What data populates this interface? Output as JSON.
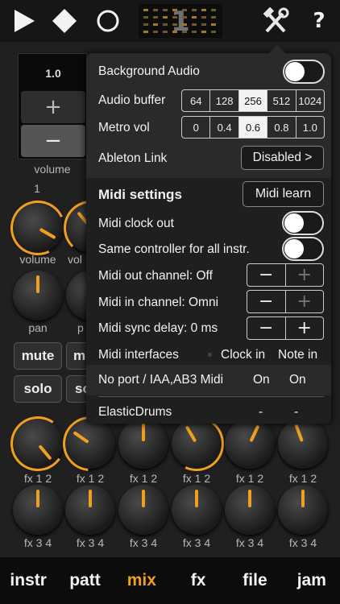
{
  "toolbar": {
    "play": "play-icon",
    "stop": "stop-icon",
    "record": "record-icon",
    "pattern_number": "1",
    "tools": "tools-icon",
    "help_label": "?"
  },
  "mixer": {
    "volume_value": "1.0",
    "volume_plus": "+",
    "volume_minus": "−",
    "volume_label": "volume",
    "channel_number": "1",
    "knob_volume": "volume",
    "knob_volume_partial": "vol",
    "knob_pan": "pan",
    "knob_pan_partial": "p",
    "mute": "mute",
    "mute_partial": "m",
    "solo": "solo",
    "solo_partial": "so",
    "fx12": "fx 1 2",
    "fx34": "fx 3 4"
  },
  "settings": {
    "background_audio": {
      "label": "Background Audio",
      "on": false
    },
    "audio_buffer": {
      "label": "Audio buffer",
      "options": [
        "64",
        "128",
        "256",
        "512",
        "1024"
      ],
      "selected": "256"
    },
    "metro_vol": {
      "label": "Metro vol",
      "options": [
        "0",
        "0.4",
        "0.6",
        "0.8",
        "1.0"
      ],
      "selected": "0.6"
    },
    "ableton_link": {
      "label": "Ableton Link",
      "value": "Disabled >"
    },
    "midi_settings": {
      "label": "Midi settings",
      "learn": "Midi learn"
    },
    "midi_clock_out": {
      "label": "Midi clock out",
      "on": false
    },
    "same_controller": {
      "label": "Same controller for all instr.",
      "on": false
    },
    "midi_out_channel": {
      "label": "Midi out channel: Off",
      "minus": "−",
      "plus": "+"
    },
    "midi_in_channel": {
      "label": "Midi in channel: Omni",
      "minus": "−",
      "plus": "+"
    },
    "midi_sync_delay": {
      "label": "Midi sync delay: 0 ms",
      "minus": "−",
      "plus": "+"
    },
    "midi_interfaces": {
      "label": "Midi interfaces",
      "col1": "Clock in",
      "col2": "Note in"
    },
    "ports": [
      {
        "name": "No port / IAA,AB3 Midi",
        "clock": "On",
        "note": "On"
      },
      {
        "name": "ElasticDrums",
        "clock": "-",
        "note": "-"
      }
    ]
  },
  "tabs": [
    "instr",
    "patt",
    "mix",
    "fx",
    "file",
    "jam"
  ],
  "active_tab": "mix",
  "colors": {
    "accent": "#f0a020",
    "popup": "#2a2a2a",
    "background": "#202020"
  }
}
